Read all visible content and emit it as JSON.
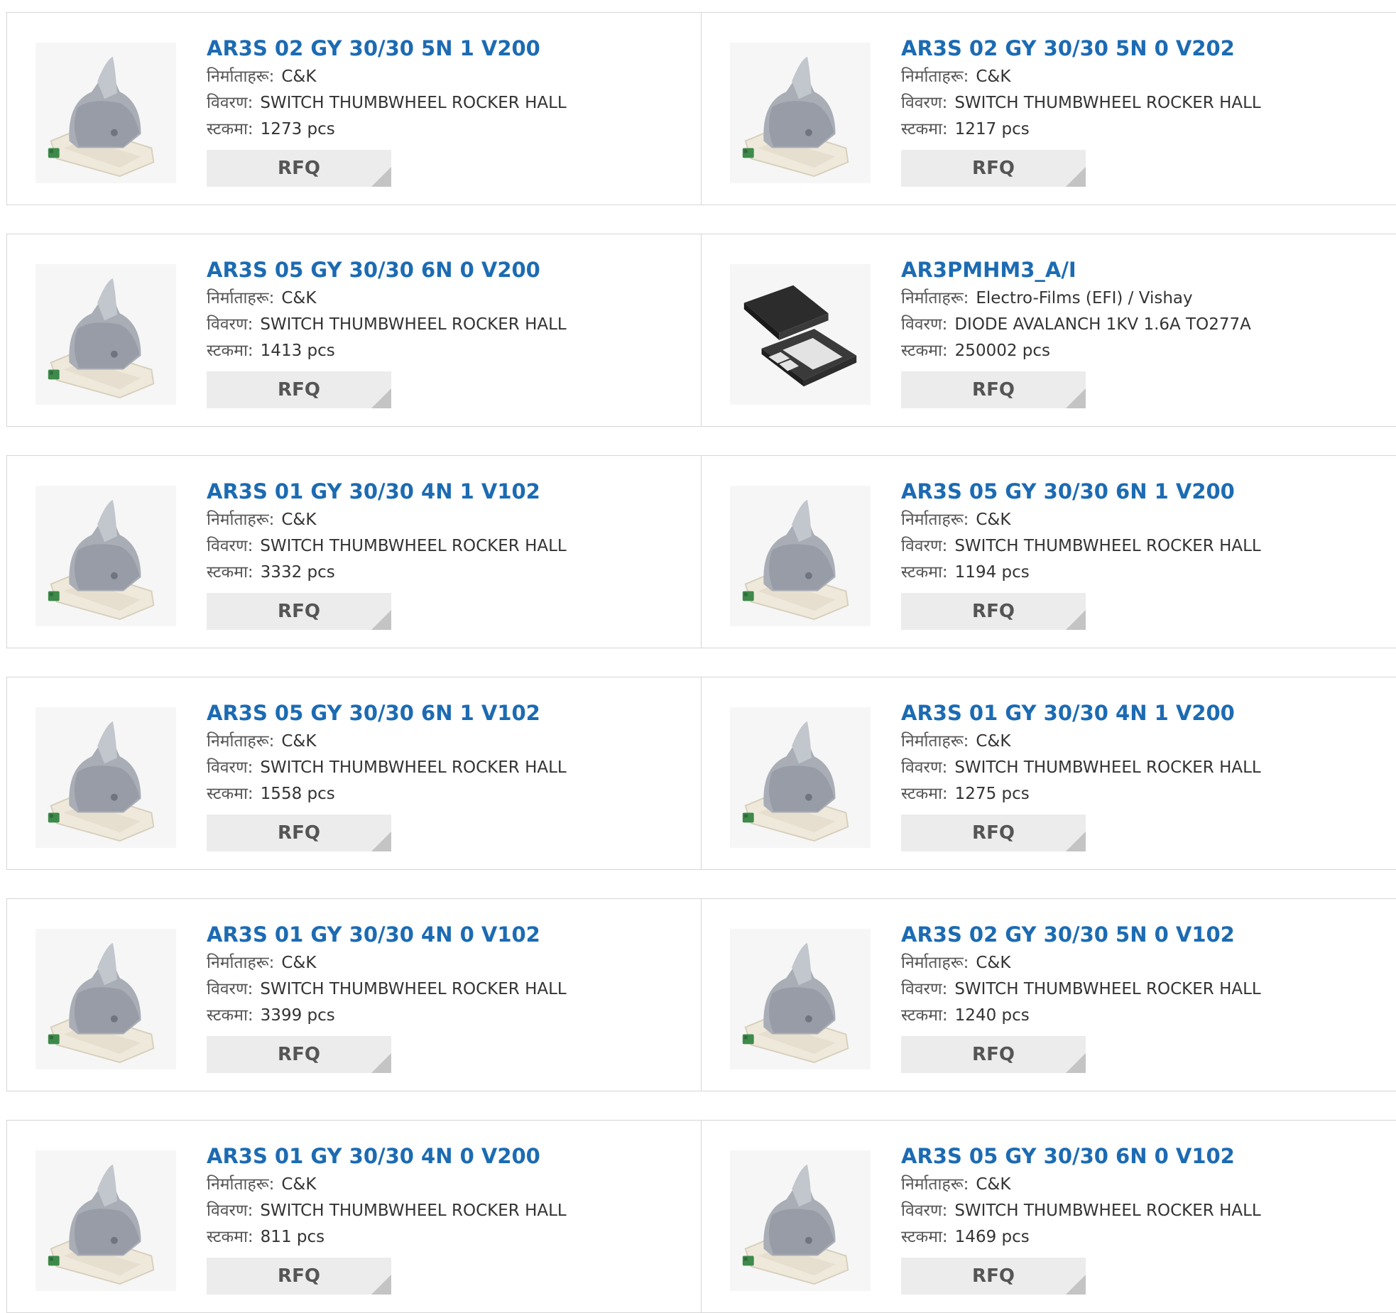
{
  "labels": {
    "mfr": "निर्माताहरू:",
    "desc": "विवरण:",
    "stock": "स्टकमा:",
    "rfq": "RFQ"
  },
  "products": [
    {
      "name": "AR3S 02 GY 30/30 5N 1 V200",
      "mfr": "C&K",
      "desc": "SWITCH THUMBWHEEL ROCKER HALL",
      "stock": "1273 pcs",
      "img": "rocker-switch-icon"
    },
    {
      "name": "AR3S 02 GY 30/30 5N 0 V202",
      "mfr": "C&K",
      "desc": "SWITCH THUMBWHEEL ROCKER HALL",
      "stock": "1217 pcs",
      "img": "rocker-switch-icon"
    },
    {
      "name": "AR3S 05 GY 30/30 6N 0 V200",
      "mfr": "C&K",
      "desc": "SWITCH THUMBWHEEL ROCKER HALL",
      "stock": "1413 pcs",
      "img": "rocker-switch-icon"
    },
    {
      "name": "AR3PMHM3_A/I",
      "mfr": "Electro-Films (EFI) / Vishay",
      "desc": "DIODE AVALANCH 1KV 1.6A TO277A",
      "stock": "250002 pcs",
      "img": "smd-diode-icon"
    },
    {
      "name": "AR3S 01 GY 30/30 4N 1 V102",
      "mfr": "C&K",
      "desc": "SWITCH THUMBWHEEL ROCKER HALL",
      "stock": "3332 pcs",
      "img": "rocker-switch-icon"
    },
    {
      "name": "AR3S 05 GY 30/30 6N 1 V200",
      "mfr": "C&K",
      "desc": "SWITCH THUMBWHEEL ROCKER HALL",
      "stock": "1194 pcs",
      "img": "rocker-switch-icon"
    },
    {
      "name": "AR3S 05 GY 30/30 6N 1 V102",
      "mfr": "C&K",
      "desc": "SWITCH THUMBWHEEL ROCKER HALL",
      "stock": "1558 pcs",
      "img": "rocker-switch-icon"
    },
    {
      "name": "AR3S 01 GY 30/30 4N 1 V200",
      "mfr": "C&K",
      "desc": "SWITCH THUMBWHEEL ROCKER HALL",
      "stock": "1275 pcs",
      "img": "rocker-switch-icon"
    },
    {
      "name": "AR3S 01 GY 30/30 4N 0 V102",
      "mfr": "C&K",
      "desc": "SWITCH THUMBWHEEL ROCKER HALL",
      "stock": "3399 pcs",
      "img": "rocker-switch-icon"
    },
    {
      "name": "AR3S 02 GY 30/30 5N 0 V102",
      "mfr": "C&K",
      "desc": "SWITCH THUMBWHEEL ROCKER HALL",
      "stock": "1240 pcs",
      "img": "rocker-switch-icon"
    },
    {
      "name": "AR3S 01 GY 30/30 4N 0 V200",
      "mfr": "C&K",
      "desc": "SWITCH THUMBWHEEL ROCKER HALL",
      "stock": "811 pcs",
      "img": "rocker-switch-icon"
    },
    {
      "name": "AR3S 05 GY 30/30 6N 0 V102",
      "mfr": "C&K",
      "desc": "SWITCH THUMBWHEEL ROCKER HALL",
      "stock": "1469 pcs",
      "img": "rocker-switch-icon"
    }
  ],
  "colors": {
    "link": "#1c6bb3",
    "border": "#d6d6d6",
    "button_bg": "#ececec"
  }
}
